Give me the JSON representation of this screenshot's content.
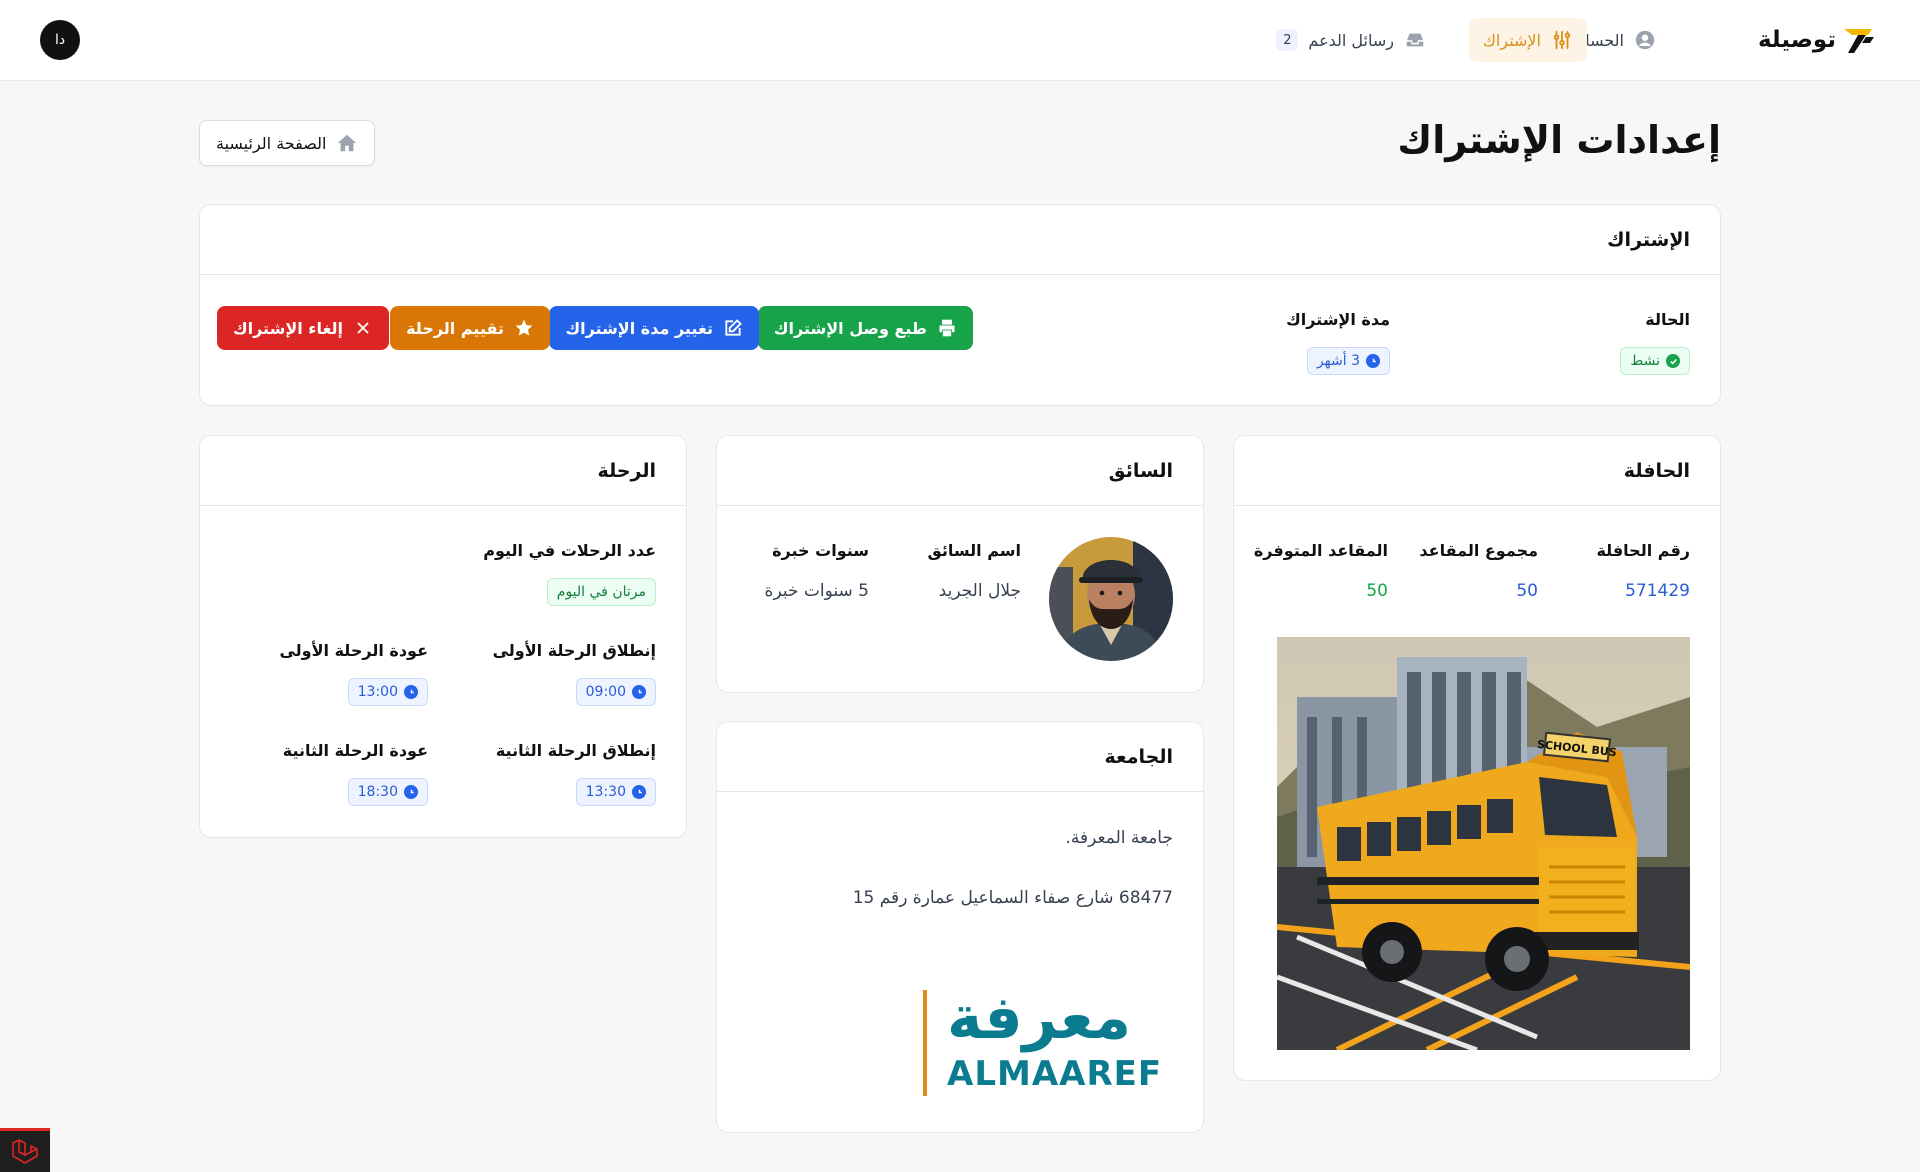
{
  "header": {
    "logo_text": "توصيلة",
    "nav": {
      "account": "الحساب",
      "subscription": "الإشتراك",
      "support": "رسائل الدعم",
      "support_count": "2"
    },
    "avatar_initials": "دا"
  },
  "page": {
    "title": "إعدادات الإشتراك",
    "home_button": "الصفحة الرئيسية"
  },
  "subscription": {
    "title": "الإشتراك",
    "status_label": "الحالة",
    "status_value": "نشط",
    "duration_label": "مدة الإشتراك",
    "duration_value": "3 أشهر",
    "buttons": {
      "print": "طبع وصل الإشتراك",
      "change": "تغيير مدة الإشتراك",
      "rate": "تقييم الرحلة",
      "cancel": "إلغاء الإشتراك"
    }
  },
  "bus": {
    "title": "الحافلة",
    "number_label": "رقم الحافلة",
    "number_value": "571429",
    "seats_label": "مجموع المقاعد",
    "seats_value": "50",
    "available_label": "المقاعد المتوفرة",
    "available_value": "50",
    "sign_text": "SCHOOL BUS"
  },
  "driver": {
    "title": "السائق",
    "name_label": "اسم السائق",
    "name_value": "جلال الجريد",
    "exp_label": "سنوات خبرة",
    "exp_value": "5 سنوات خبرة"
  },
  "university": {
    "title": "الجامعة",
    "name": "جامعة المعرفة.",
    "address": "68477 شارع صفاء السماعيل عمارة رقم 15",
    "logo_ar": "معرفة",
    "logo_en": "ALMAAREF"
  },
  "trip": {
    "title": "الرحلة",
    "count_label": "عدد الرحلات في اليوم",
    "count_value": "مرتان في اليوم",
    "first_start_label": "إنطلاق الرحلة الأولى",
    "first_start_value": "09:00",
    "first_return_label": "عودة الرحلة الأولى",
    "first_return_value": "13:00",
    "second_start_label": "إنطلاق الرحلة الثانية",
    "second_start_value": "13:30",
    "second_return_label": "عودة الرحلة الثانية",
    "second_return_value": "18:30"
  },
  "colors": {
    "accent": "#d99019",
    "green": "#16a34a",
    "blue": "#2563eb",
    "orange": "#d97706",
    "red": "#dc2626"
  }
}
